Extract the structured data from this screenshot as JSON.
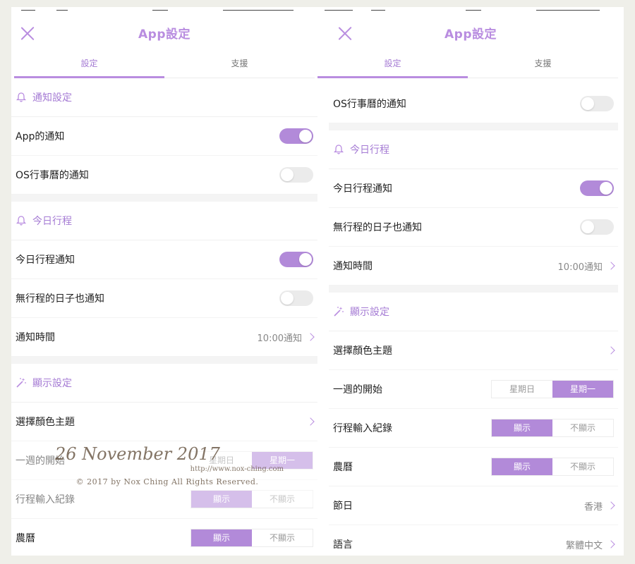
{
  "header": {
    "title": "App設定"
  },
  "tabs": [
    {
      "label": "設定"
    },
    {
      "label": "支援"
    }
  ],
  "left": {
    "notify_section": "通知設定",
    "app_notify": "App的通知",
    "os_notify": "OS行事曆的通知",
    "today_section": "今日行程",
    "today_notify": "今日行程通知",
    "no_event_notify": "無行程的日子也通知",
    "notify_time": "通知時間",
    "notify_time_value": "10:00通知",
    "display_section": "顯示設定",
    "color_theme": "選擇顏色主題",
    "week_start": "一週的開始",
    "week_sun": "星期日",
    "week_mon": "星期一",
    "input_log": "行程輸入紀錄",
    "show": "顯示",
    "hide": "不顯示",
    "lunar": "農曆"
  },
  "right": {
    "os_notify": "OS行事曆的通知",
    "today_section": "今日行程",
    "today_notify": "今日行程通知",
    "no_event_notify": "無行程的日子也通知",
    "notify_time": "通知時間",
    "notify_time_value": "10:00通知",
    "display_section": "顯示設定",
    "color_theme": "選擇顏色主題",
    "week_start": "一週的開始",
    "week_sun": "星期日",
    "week_mon": "星期一",
    "input_log": "行程輸入紀錄",
    "show": "顯示",
    "hide": "不顯示",
    "lunar": "農曆",
    "holiday": "節日",
    "holiday_value": "香港",
    "language": "語言",
    "language_value": "繁體中文"
  },
  "watermark": {
    "date": "26 November 2017",
    "url": "http://www.nox-ching.com",
    "copyright": "© 2017 by Nox Ching All Rights Reserved."
  },
  "toggles": {
    "app_notify": true,
    "os_notify": false,
    "today_notify": true,
    "no_event_notify": false
  },
  "colors": {
    "accent": "#b98de0",
    "toggle_on": "#b28ad9",
    "toggle_off": "#ebebeb"
  }
}
